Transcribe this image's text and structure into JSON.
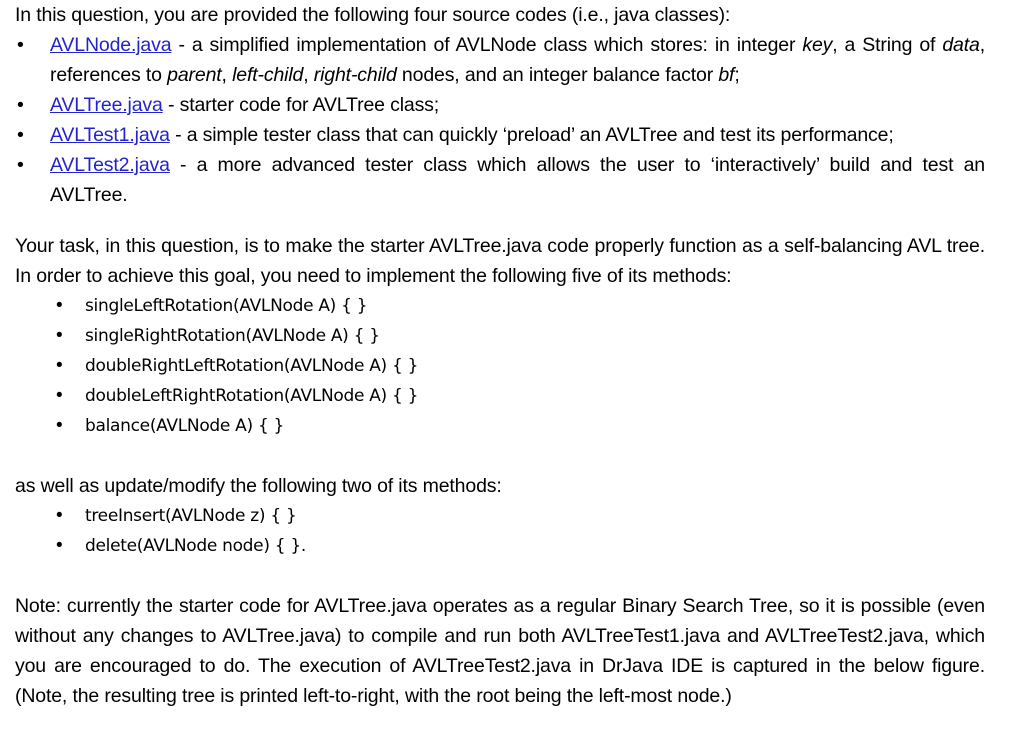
{
  "document": {
    "intro": "In this question, you are provided the following four source codes (i.e., java classes):",
    "source_files": [
      {
        "link": "AVLNode.java",
        "text_before_italics": " - a simplified implementation of AVLNode class which stores: in integer ",
        "segments": [
          {
            "type": "text",
            "value": " - a simplified implementation of AVLNode class which stores: in integer "
          },
          {
            "type": "italic",
            "value": "key"
          },
          {
            "type": "text",
            "value": ", a String of "
          },
          {
            "type": "italic",
            "value": "data"
          },
          {
            "type": "text",
            "value": ", references to "
          },
          {
            "type": "italic",
            "value": "parent"
          },
          {
            "type": "text",
            "value": ", "
          },
          {
            "type": "italic",
            "value": "left-child"
          },
          {
            "type": "text",
            "value": ", "
          },
          {
            "type": "italic",
            "value": "right-child"
          },
          {
            "type": "text",
            "value": " nodes, and an integer balance factor "
          },
          {
            "type": "italic",
            "value": "bf"
          },
          {
            "type": "text",
            "value": ";"
          }
        ]
      },
      {
        "link": "AVLTree.java",
        "segments": [
          {
            "type": "text",
            "value": " - starter code for AVLTree class;"
          }
        ]
      },
      {
        "link": "AVLTest1.java",
        "segments": [
          {
            "type": "text",
            "value": " - a simple tester class that can quickly ‘preload’ an AVLTree and test its performance;"
          }
        ]
      },
      {
        "link": "AVLTest2.java",
        "segments": [
          {
            "type": "text",
            "value": " - a more advanced tester class which allows the user to ‘interactively’ build and test an AVLTree."
          }
        ]
      }
    ],
    "task_paragraph": "Your task, in this question, is to make the starter AVLTree.java code properly function as a self-balancing AVL tree. In order to achieve this goal, you need to implement the following five of its methods:",
    "implement_methods": [
      "singleLeftRotation(AVLNode A) { }",
      "singleRightRotation(AVLNode A) { }",
      "doubleRightLeftRotation(AVLNode A) { }",
      "doubleLeftRightRotation(AVLNode A) { }",
      "balance(AVLNode A) { }"
    ],
    "modify_intro": "as well as update/modify the following two of its methods:",
    "modify_methods": [
      "treeInsert(AVLNode z) { }",
      "delete(AVLNode node) { }."
    ],
    "note_paragraph": "Note: currently the starter code for AVLTree.java operates as a regular Binary Search Tree, so it is possible (even without any changes to AVLTree.java) to compile and run both AVLTreeTest1.java and AVLTreeTest2.java, which you are encouraged to do. The execution of AVLTreeTest2.java in DrJava IDE is captured in the below figure. (Note, the resulting tree is printed left-to-right, with the root being the left-most node.)",
    "bullet_glyph": "•",
    "link_color": "#2323cc",
    "text_color": "#000000",
    "background_color": "#ffffff"
  }
}
